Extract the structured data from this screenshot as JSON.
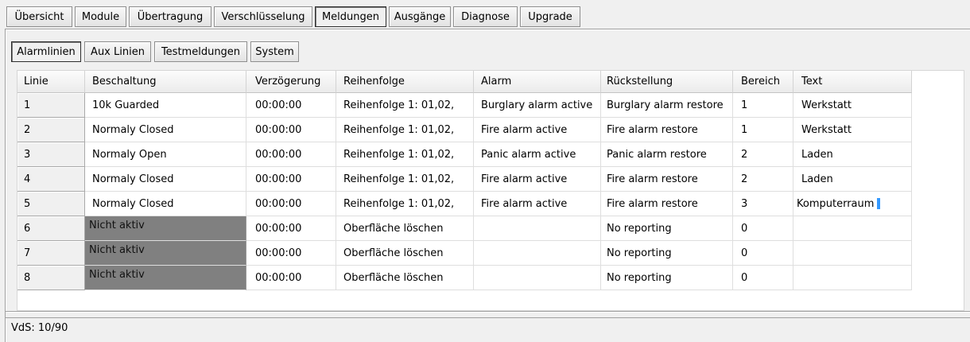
{
  "main_tabs": [
    {
      "label": "Übersicht",
      "selected": false
    },
    {
      "label": "Module",
      "selected": false
    },
    {
      "label": "Übertragung",
      "selected": false
    },
    {
      "label": "Verschlüsselung",
      "selected": false
    },
    {
      "label": "Meldungen",
      "selected": true
    },
    {
      "label": "Ausgänge",
      "selected": false
    },
    {
      "label": "Diagnose",
      "selected": false
    },
    {
      "label": "Upgrade",
      "selected": false
    }
  ],
  "sub_tabs": [
    {
      "label": "Alarmlinien",
      "selected": true
    },
    {
      "label": "Aux Linien",
      "selected": false
    },
    {
      "label": "Testmeldungen",
      "selected": false
    },
    {
      "label": "System",
      "selected": false
    }
  ],
  "grid": {
    "columns": [
      "Linie",
      "Beschaltung",
      "Verzögerung",
      "Reihenfolge",
      "Alarm",
      "Rückstellung",
      "Bereich",
      "Text"
    ],
    "rows": [
      {
        "linie": "1",
        "beschaltung": "10k Guarded",
        "verzoegerung": "00:00:00",
        "reihenfolge": "Reihenfolge 1: 01,02,",
        "alarm": "Burglary alarm active",
        "rueckstellung": "Burglary alarm restore",
        "bereich": "1",
        "text": "Werkstatt",
        "inactive": false,
        "editing_text": false
      },
      {
        "linie": "2",
        "beschaltung": "Normaly Closed",
        "verzoegerung": "00:00:00",
        "reihenfolge": "Reihenfolge 1: 01,02,",
        "alarm": "Fire alarm active",
        "rueckstellung": "Fire alarm restore",
        "bereich": "1",
        "text": "Werkstatt",
        "inactive": false,
        "editing_text": false
      },
      {
        "linie": "3",
        "beschaltung": "Normaly Open",
        "verzoegerung": "00:00:00",
        "reihenfolge": "Reihenfolge 1: 01,02,",
        "alarm": "Panic alarm active",
        "rueckstellung": "Panic alarm restore",
        "bereich": "2",
        "text": "Laden",
        "inactive": false,
        "editing_text": false
      },
      {
        "linie": "4",
        "beschaltung": "Normaly Closed",
        "verzoegerung": "00:00:00",
        "reihenfolge": "Reihenfolge 1: 01,02,",
        "alarm": "Fire alarm active",
        "rueckstellung": "Fire alarm restore",
        "bereich": "2",
        "text": "Laden",
        "inactive": false,
        "editing_text": false
      },
      {
        "linie": "5",
        "beschaltung": "Normaly Closed",
        "verzoegerung": "00:00:00",
        "reihenfolge": "Reihenfolge 1: 01,02,",
        "alarm": "Fire alarm active",
        "rueckstellung": "Fire alarm restore",
        "bereich": "3",
        "text": "Komputerraum",
        "inactive": false,
        "editing_text": true
      },
      {
        "linie": "6",
        "beschaltung": "Nicht aktiv",
        "verzoegerung": "00:00:00",
        "reihenfolge": "Oberfläche löschen",
        "alarm": "",
        "rueckstellung": "No reporting",
        "bereich": "0",
        "text": "",
        "inactive": true,
        "editing_text": false
      },
      {
        "linie": "7",
        "beschaltung": "Nicht aktiv",
        "verzoegerung": "00:00:00",
        "reihenfolge": "Oberfläche löschen",
        "alarm": "",
        "rueckstellung": "No reporting",
        "bereich": "0",
        "text": "",
        "inactive": true,
        "editing_text": false
      },
      {
        "linie": "8",
        "beschaltung": "Nicht aktiv",
        "verzoegerung": "00:00:00",
        "reihenfolge": "Oberfläche löschen",
        "alarm": "",
        "rueckstellung": "No reporting",
        "bereich": "0",
        "text": "",
        "inactive": true,
        "editing_text": false
      }
    ]
  },
  "status": {
    "text": "VdS: 10/90"
  },
  "colors": {
    "inactive_cell": "#808080",
    "caret": "#3399ff"
  }
}
